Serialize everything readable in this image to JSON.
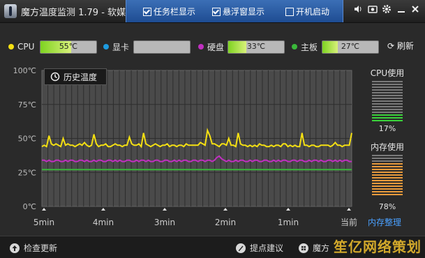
{
  "app": {
    "title": "魔方温度监测 1.79 - 软媒"
  },
  "options": [
    {
      "label": "任务栏显示",
      "checked": true
    },
    {
      "label": "悬浮窗显示",
      "checked": true
    },
    {
      "label": "开机启动",
      "checked": false
    }
  ],
  "window_buttons": [
    "speaker-icon",
    "camera-icon",
    "gear-icon",
    "minimize-icon",
    "close-icon"
  ],
  "sensors": [
    {
      "name": "CPU",
      "color": "#f5e012",
      "value": "55℃",
      "level": 0.55
    },
    {
      "name": "显卡",
      "color": "#1e9be0",
      "value": "",
      "level": 0
    },
    {
      "name": "硬盘",
      "color": "#c030c0",
      "value": "33℃",
      "level": 0.33
    },
    {
      "name": "主板",
      "color": "#3ab83a",
      "value": "27℃",
      "level": 0.27
    }
  ],
  "refresh_label": "刷新",
  "history_button": "历史温度",
  "chart_data": {
    "type": "line",
    "x": [
      "5min",
      "4min",
      "3min",
      "2min",
      "1min",
      "当前"
    ],
    "ylim": [
      0,
      100
    ],
    "ytick_labels": [
      "100℃",
      "75℃",
      "50℃",
      "25℃",
      "0℃"
    ],
    "grid": true,
    "series": [
      {
        "name": "CPU",
        "color": "#f5e012",
        "values": [
          44,
          45,
          44,
          52,
          46,
          45,
          46,
          45,
          44,
          50,
          45,
          46,
          45,
          45,
          44,
          45,
          46,
          45,
          47,
          45,
          44,
          45,
          53,
          46,
          44,
          45,
          45,
          46,
          44,
          44,
          45,
          46,
          45,
          45,
          44,
          45,
          45,
          51,
          46,
          45,
          45,
          46,
          44,
          54,
          46,
          45,
          44,
          45,
          46,
          45,
          44,
          45,
          45,
          46,
          44,
          45,
          45,
          44,
          45,
          45,
          44,
          46,
          45,
          45,
          45,
          45,
          45,
          47,
          46,
          45,
          56,
          52,
          46,
          46,
          45,
          44,
          46,
          46,
          45,
          50,
          45,
          45,
          44,
          54,
          46,
          45,
          45,
          44,
          45,
          44,
          45,
          44,
          46,
          45,
          45,
          44,
          44,
          45,
          44,
          45,
          45,
          44,
          46,
          46,
          44,
          45,
          44,
          45,
          44,
          44,
          54,
          45,
          45,
          44,
          45,
          45,
          44,
          44,
          45,
          45,
          45,
          45,
          44,
          45,
          47,
          45,
          45,
          44,
          45,
          45,
          45,
          54
        ]
      },
      {
        "name": "硬盘",
        "color": "#c030c0",
        "values": [
          34,
          34,
          33,
          34,
          33,
          33,
          34,
          34,
          33,
          33,
          34,
          33,
          34,
          34,
          33,
          33,
          34,
          34,
          33,
          34,
          33,
          33,
          34,
          33,
          34,
          34,
          33,
          33,
          34,
          34,
          33,
          34,
          33,
          34,
          33,
          33,
          34,
          34,
          33,
          33,
          34,
          33,
          34,
          34,
          33,
          34,
          33,
          33,
          34,
          34,
          33,
          33,
          34,
          34,
          33,
          33,
          34,
          33,
          34,
          33,
          34,
          34,
          33,
          33,
          34,
          34,
          33,
          34,
          34,
          33,
          34,
          34,
          33,
          34,
          36,
          37,
          35,
          34,
          33,
          34,
          33,
          33,
          34,
          33,
          34,
          34,
          33,
          33,
          34,
          33,
          34,
          34,
          33,
          33,
          34,
          34,
          33,
          33,
          34,
          33,
          34,
          33,
          34,
          34,
          33,
          33,
          34,
          34,
          33,
          34,
          34,
          33,
          33,
          34,
          33,
          34,
          34,
          33,
          34,
          33,
          33,
          34,
          34,
          33,
          34,
          33,
          34,
          33,
          34,
          34,
          33,
          33
        ]
      },
      {
        "name": "主板",
        "color": "#3ab83a",
        "values": [
          27,
          27,
          27,
          27,
          27,
          27,
          27,
          27,
          27,
          27,
          27,
          27,
          27,
          27,
          27,
          27,
          27,
          27,
          27,
          27,
          27,
          27,
          27,
          27,
          27,
          27,
          27,
          27,
          27,
          27,
          27,
          27,
          27,
          27,
          27,
          27,
          27,
          27,
          27,
          27,
          27,
          27,
          27,
          27,
          27,
          27,
          27,
          27,
          27,
          27,
          27,
          27,
          27,
          27,
          27,
          27,
          27,
          27,
          27,
          27,
          27,
          27,
          27,
          27,
          27,
          27,
          27,
          27,
          27,
          27,
          27,
          27,
          27,
          27,
          27,
          27,
          27,
          27,
          27,
          27,
          27,
          27,
          27,
          27,
          27,
          27,
          27,
          27,
          27,
          27,
          27,
          27,
          27,
          27,
          27,
          27,
          27,
          27,
          27,
          27,
          27,
          27,
          27,
          27,
          27,
          27,
          27,
          27,
          27,
          27,
          27,
          27,
          27,
          27,
          27,
          27,
          27,
          27,
          27,
          27,
          27,
          27,
          27,
          27,
          27,
          27,
          27,
          27,
          27,
          27,
          27,
          27
        ]
      }
    ]
  },
  "cpu_usage": {
    "label": "CPU使用",
    "value": "17%",
    "level": 0.17
  },
  "mem_usage": {
    "label": "内存使用",
    "value": "78%",
    "level": 0.78
  },
  "mem_manage_link": "内存整理",
  "bottom": {
    "check_update": "检查更新",
    "suggest": "提点建议",
    "more": "魔方"
  },
  "watermark": "笙亿网络策划"
}
